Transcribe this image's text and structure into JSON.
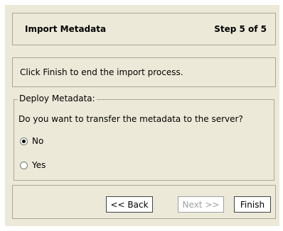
{
  "header": {
    "title": "Import Metadata",
    "step": "Step 5 of 5"
  },
  "info": {
    "text": "Click Finish to end the import process."
  },
  "deploy": {
    "legend": "Deploy Metadata:",
    "question": "Do you want to transfer the metadata to the server?",
    "options": [
      {
        "label": "No",
        "selected": true
      },
      {
        "label": "Yes",
        "selected": false
      }
    ]
  },
  "buttons": {
    "back": "<< Back",
    "next": "Next >>",
    "finish": "Finish"
  }
}
